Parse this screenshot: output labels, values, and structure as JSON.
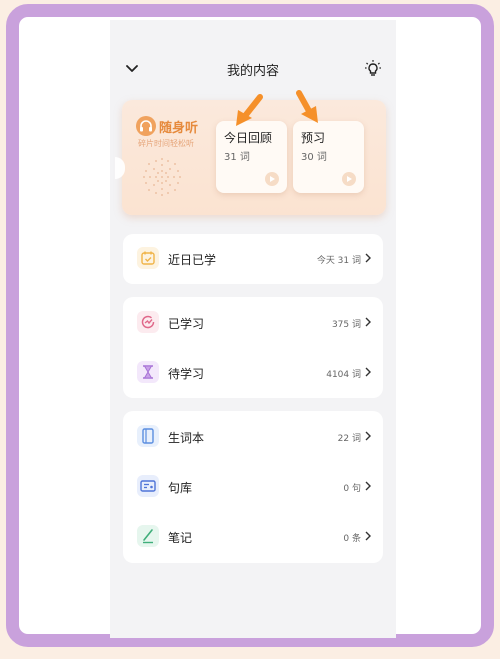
{
  "header": {
    "title": "我的内容"
  },
  "banner": {
    "brand_name": "随身听",
    "brand_slogan": "碎片时间轻松听",
    "cards": [
      {
        "title": "今日回顾",
        "count": "31 词"
      },
      {
        "title": "预习",
        "count": "30 词"
      }
    ]
  },
  "sections": [
    {
      "rows": [
        {
          "label": "近日已学",
          "value": "今天 31 词",
          "icon": "calendar-check-icon"
        }
      ]
    },
    {
      "rows": [
        {
          "label": "已学习",
          "value": "375 词",
          "icon": "progress-icon"
        },
        {
          "label": "待学习",
          "value": "4104 词",
          "icon": "hourglass-icon"
        }
      ]
    },
    {
      "rows": [
        {
          "label": "生词本",
          "value": "22 词",
          "icon": "notebook-icon"
        },
        {
          "label": "句库",
          "value": "0 句",
          "icon": "card-icon"
        },
        {
          "label": "笔记",
          "value": "0 条",
          "icon": "pen-icon"
        }
      ]
    }
  ],
  "colors": {
    "frame_border": "#c9a1dc",
    "accent_orange": "#f5902a",
    "banner_bg": "#fbe6d6"
  }
}
